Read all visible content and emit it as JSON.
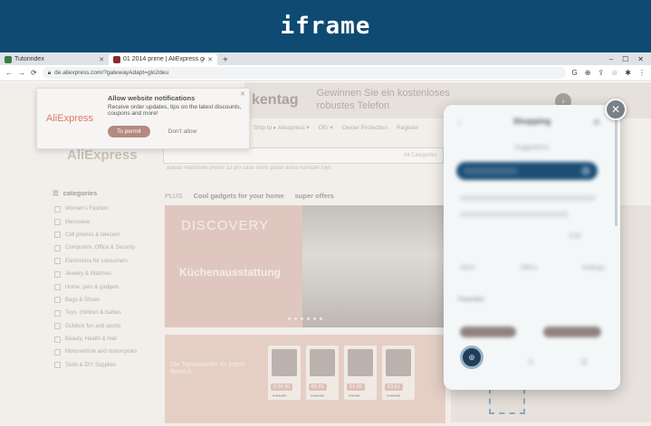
{
  "banner": {
    "title": "iframe"
  },
  "browser": {
    "tabs": [
      {
        "label": "Tutorindex",
        "favicon": "green"
      },
      {
        "label": "01 2014 prime | AliExpress gente...",
        "favicon": "red"
      }
    ],
    "new_tab": "+",
    "window_controls": [
      "–",
      "☐",
      "✕"
    ],
    "url": "de.aliexpress.com/?gatewayAdapt=glo2deu",
    "nav_icons": [
      "←",
      "→",
      "⟳"
    ],
    "toolbar_icons": [
      "G",
      "⊕",
      "⇪",
      "☆",
      "✱",
      "⋮"
    ]
  },
  "page": {
    "promo_word": "kentag",
    "promo_text": "Gewinnen Sie ein kostenloses robustes Telefon",
    "promo_arrow": "›",
    "notification": {
      "logo": "AliExpress",
      "title": "Allow website notifications",
      "body": "Receive order updates, tips on the latest discounts, coupons and more!",
      "permit": "To permit",
      "deny": "Don't allow",
      "close": "✕"
    },
    "nav": [
      "Ship to ▸ Aliexpress ▾",
      "DE/ ▾",
      "Owner Protection",
      "Register"
    ],
    "logo": "AliExpress",
    "search_placeholder": "All Categories",
    "hot_searches": "adidas Wardrobe   phone 13 pro case   shirts  paste dress   hamster toys",
    "sidebar": {
      "heading": "categories",
      "items": [
        "Women's Fashion",
        "Menswear",
        "Cell phones & telecom",
        "Computers, Office & Security",
        "Electronics for consumers",
        "Jewelry & Watches",
        "Home, pets & gadgets",
        "Bags & Shoes",
        "Toys, children & babies",
        "Outdoor fun and sports",
        "Beauty, Health & Hair",
        "Motorvehicle and motorcycles",
        "Tools & DIY Supplies"
      ]
    },
    "tabs": {
      "plus": "PLUS",
      "t1": "Cool gadgets for your home",
      "t2": "super offers"
    },
    "hero": {
      "brand": "DISCOVERY",
      "subtitle": "Küchenausstattung"
    },
    "deal": {
      "text": "Die Topverkäufer für jeden Bereich",
      "cards": [
        {
          "price": "€ 24.30",
          "old": "€ 81.00"
        },
        {
          "price": "€6.81",
          "old": "€ 14.32"
        },
        {
          "price": "€1.99",
          "old": "€ 3.86"
        },
        {
          "price": "€9.61",
          "old": "€ 18.32"
        }
      ]
    }
  },
  "modal": {
    "back": "‹",
    "title": "Shopping",
    "settings": "⚙",
    "caption": "Suggestions",
    "side_value": "3.00",
    "tabs": [
      "Store",
      "Offers",
      "Settings"
    ],
    "section": "Favorites",
    "fab": "⊕",
    "bottom_icons": [
      "⌂",
      "⊙",
      "☰"
    ],
    "close": "✕"
  }
}
